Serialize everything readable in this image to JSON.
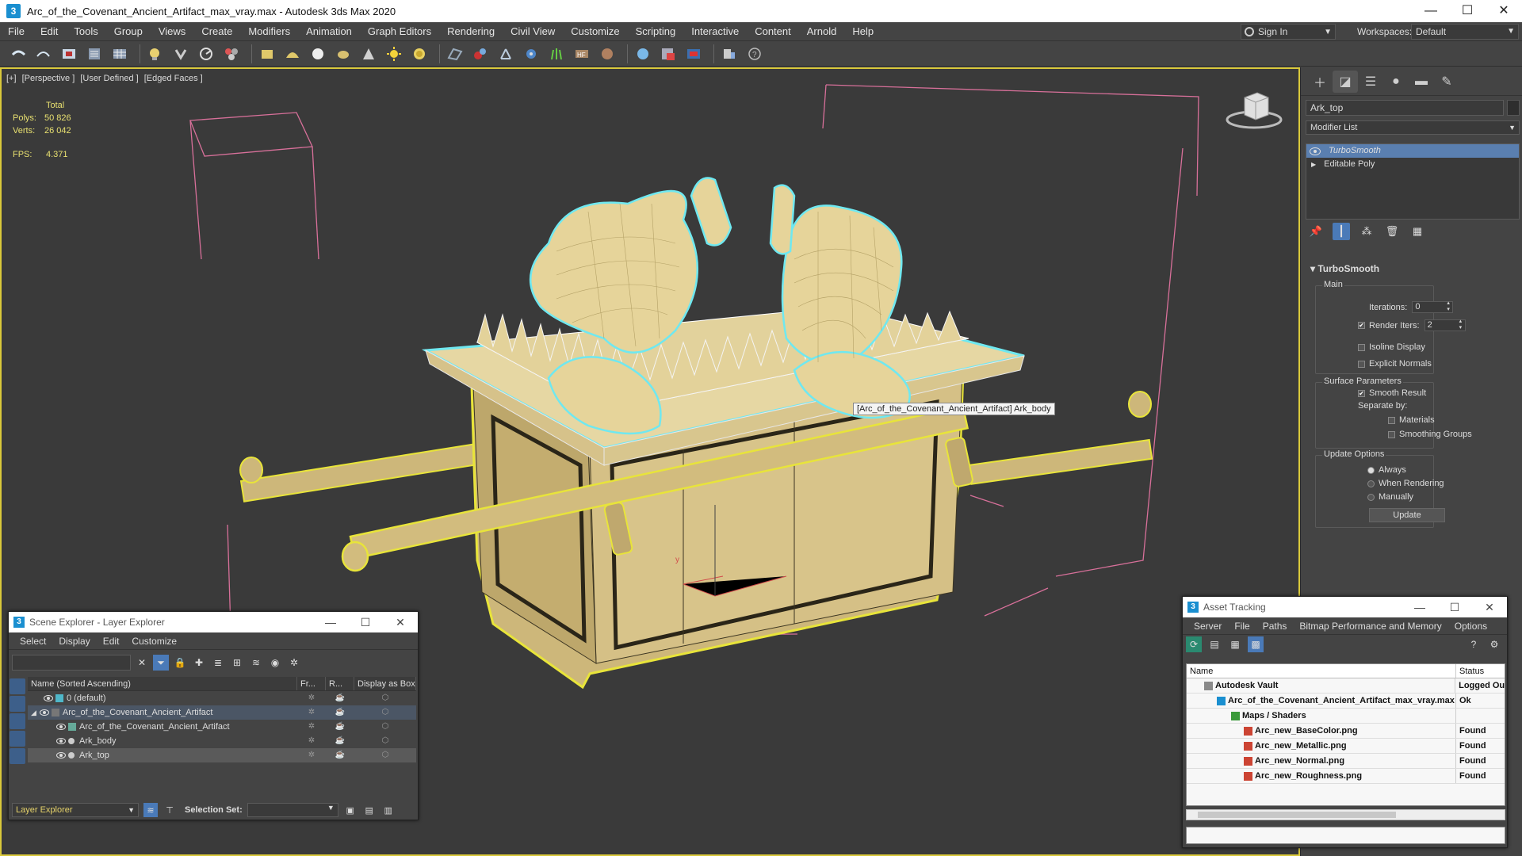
{
  "window": {
    "title": "Arc_of_the_Covenant_Ancient_Artifact_max_vray.max - Autodesk 3ds Max 2020",
    "app_icon": "3"
  },
  "menu": [
    "File",
    "Edit",
    "Tools",
    "Group",
    "Views",
    "Create",
    "Modifiers",
    "Animation",
    "Graph Editors",
    "Rendering",
    "Civil View",
    "Customize",
    "Scripting",
    "Interactive",
    "Content",
    "Arnold",
    "Help"
  ],
  "account": {
    "sign_in": "Sign In",
    "workspaces_label": "Workspaces:",
    "workspace": "Default"
  },
  "viewport": {
    "labels": [
      "[+]",
      "[Perspective ]",
      "[User Defined ]",
      "[Edged Faces ]"
    ],
    "stats": {
      "total_label": "Total",
      "polys_label": "Polys:",
      "polys": "50 826",
      "verts_label": "Verts:",
      "verts": "26 042",
      "fps_label": "FPS:",
      "fps": "4.371"
    },
    "tooltip": "[Arc_of_the_Covenant_Ancient_Artifact] Ark_body"
  },
  "command_panel": {
    "object_name": "Ark_top",
    "modifier_list": "Modifier List",
    "stack": [
      "TurboSmooth",
      "Editable Poly"
    ],
    "rollout_title": "TurboSmooth",
    "main_label": "Main",
    "iterations_label": "Iterations:",
    "iterations": "0",
    "render_iters_label": "Render Iters:",
    "render_iters": "2",
    "isoline": "Isoline Display",
    "explicit_normals": "Explicit Normals",
    "surface_params": "Surface Parameters",
    "smooth_result": "Smooth Result",
    "separate_by": "Separate by:",
    "materials": "Materials",
    "smoothing_groups": "Smoothing Groups",
    "update_options": "Update Options",
    "always": "Always",
    "when_rendering": "When Rendering",
    "manually": "Manually",
    "update_btn": "Update"
  },
  "scene_explorer": {
    "title": "Scene Explorer - Layer Explorer",
    "menu": [
      "Select",
      "Display",
      "Edit",
      "Customize"
    ],
    "columns": [
      "Name (Sorted Ascending)",
      "Fr...",
      "R...",
      "Display as Box"
    ],
    "rows": [
      "0 (default)",
      "Arc_of_the_Covenant_Ancient_Artifact",
      "Arc_of_the_Covenant_Ancient_Artifact",
      "Ark_body",
      "Ark_top"
    ],
    "footer_layer": "Layer Explorer",
    "selection_set": "Selection Set:"
  },
  "asset_tracking": {
    "title": "Asset Tracking",
    "menu": [
      "Server",
      "File",
      "Paths",
      "Bitmap Performance and Memory",
      "Options"
    ],
    "columns": [
      "Name",
      "Status"
    ],
    "rows": [
      {
        "name": "Autodesk Vault",
        "status": "Logged Ou"
      },
      {
        "name": "Arc_of_the_Covenant_Ancient_Artifact_max_vray.max",
        "status": "Ok"
      },
      {
        "name": "Maps / Shaders",
        "status": ""
      },
      {
        "name": "Arc_new_BaseColor.png",
        "status": "Found"
      },
      {
        "name": "Arc_new_Metallic.png",
        "status": "Found"
      },
      {
        "name": "Arc_new_Normal.png",
        "status": "Found"
      },
      {
        "name": "Arc_new_Roughness.png",
        "status": "Found"
      }
    ]
  },
  "colors": {
    "accent": "#4a7ab8",
    "selection_yellow": "#e8e43a",
    "selection_cyan": "#6fe8f0",
    "model": "#d8c48a",
    "bounds": "#e07aa0"
  }
}
